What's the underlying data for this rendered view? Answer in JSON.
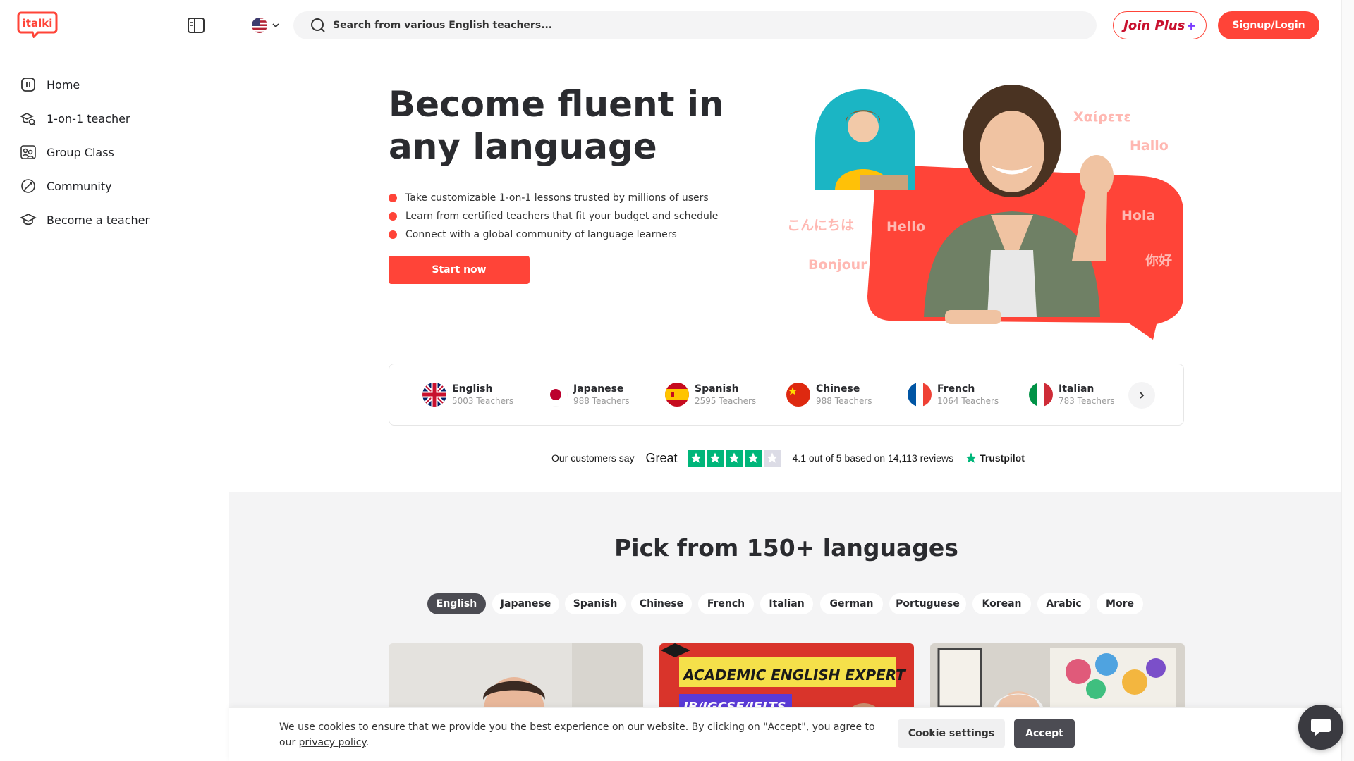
{
  "header": {
    "logo_text": "italki",
    "search_placeholder": "Search from various English teachers...",
    "join_plus_label": "Join Plus",
    "join_plus_symbol": "+",
    "signup_label": "Signup/Login"
  },
  "sidebar": {
    "items": [
      {
        "label": "Home",
        "icon": "home-icon"
      },
      {
        "label": "1-on-1 teacher",
        "icon": "teacher-search-icon"
      },
      {
        "label": "Group Class",
        "icon": "group-class-icon"
      },
      {
        "label": "Community",
        "icon": "community-icon"
      },
      {
        "label": "Become a teacher",
        "icon": "graduation-cap-icon"
      }
    ]
  },
  "hero": {
    "title": "Become fluent in any language",
    "bullets": [
      "Take customizable 1-on-1 lessons trusted by millions of users",
      "Learn from certified teachers that fit your budget and schedule",
      "Connect with a global community of language learners"
    ],
    "cta_label": "Start now",
    "greetings": {
      "greek": "Χαίρετε",
      "hallo": "Hallo",
      "japanese": "こんにちは",
      "hello": "Hello",
      "hola": "Hola",
      "bonjour": "Bonjour",
      "chinese": "你好"
    }
  },
  "languages": [
    {
      "name": "English",
      "teachers": "5003 Teachers",
      "flag": "uk-flag"
    },
    {
      "name": "Japanese",
      "teachers": "988 Teachers",
      "flag": "japan-flag"
    },
    {
      "name": "Spanish",
      "teachers": "2595 Teachers",
      "flag": "spain-flag"
    },
    {
      "name": "Chinese",
      "teachers": "988 Teachers",
      "flag": "china-flag"
    },
    {
      "name": "French",
      "teachers": "1064 Teachers",
      "flag": "france-flag"
    },
    {
      "name": "Italian",
      "teachers": "783 Teachers",
      "flag": "italy-flag"
    }
  ],
  "trustpilot": {
    "customers_say": "Our customers say",
    "rating_word": "Great",
    "score_text": "4.1 out of 5 based on 14,113 reviews",
    "brand": "Trustpilot",
    "rating": 4.1
  },
  "pick": {
    "title": "Pick from 150+ languages",
    "chips": [
      "English",
      "Japanese",
      "Spanish",
      "Chinese",
      "French",
      "Italian",
      "German",
      "Portuguese",
      "Korean",
      "Arabic",
      "More"
    ],
    "active_chip": "English",
    "card_banner_1": "ACADEMIC ENGLISH EXPERT",
    "card_banner_2": "IB/IGCSE/IELTS"
  },
  "cookie": {
    "text": "We use cookies to ensure that we provide you the best experience on our website. By clicking on \"Accept\", you agree to our",
    "link_text": "privacy policy",
    "link_suffix": ".",
    "settings_label": "Cookie settings",
    "accept_label": "Accept"
  },
  "colors": {
    "brand_red": "#ff4438",
    "dark": "#4c4c53",
    "trust_green": "#00b67a"
  }
}
